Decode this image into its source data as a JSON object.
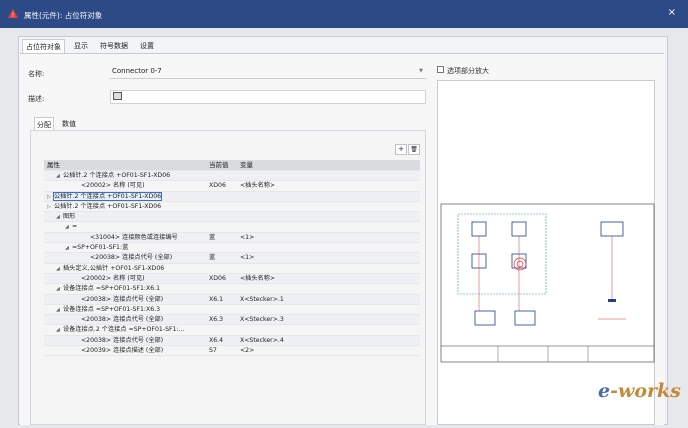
{
  "window": {
    "title": "属性(元件): 占位符对象",
    "close": "×"
  },
  "tabs": [
    "占位符对象",
    "显示",
    "符号数据",
    "设置"
  ],
  "form": {
    "name_label": "名称:",
    "name_value": "Connector 0-7",
    "desc_label": "描述:"
  },
  "subtabs": [
    "分配",
    "数值"
  ],
  "toolbar": {
    "add": "+",
    "delete": "🗑"
  },
  "table": {
    "headers": [
      "属性",
      "当前值",
      "变量"
    ],
    "rows": [
      {
        "indent": 1,
        "exp": "◢",
        "prop": "公插针.2 个连接点 +OF01-SF1-XD06",
        "val": "",
        "var": ""
      },
      {
        "indent": 3,
        "exp": "",
        "prop": "<20002> 名称 (可见)",
        "val": "XD06",
        "var": "<插头名称>"
      },
      {
        "indent": 0,
        "exp": "▷",
        "prop": "公插针.2 个连接点 +OF01-SF1-XD06",
        "val": "",
        "var": "",
        "sel": true
      },
      {
        "indent": 0,
        "exp": "▷",
        "prop": "公插针.2 个连接点 +OF01-SF1-XD06",
        "val": "",
        "var": ""
      },
      {
        "indent": 1,
        "exp": "◢",
        "prop": "图形",
        "val": "",
        "var": ""
      },
      {
        "indent": 2,
        "exp": "◢",
        "prop": "=",
        "val": "",
        "var": ""
      },
      {
        "indent": 4,
        "exp": "",
        "prop": "<31004> 连接颜色或连接编号",
        "val": "蓝",
        "var": "<1>"
      },
      {
        "indent": 2,
        "exp": "◢",
        "prop": "=SP+OF01-SF1:蓝",
        "val": "",
        "var": ""
      },
      {
        "indent": 4,
        "exp": "",
        "prop": "<20038> 连接点代号 (全部)",
        "val": "蓝",
        "var": "<1>"
      },
      {
        "indent": 1,
        "exp": "◢",
        "prop": "插头定义,公插针 +OF01-SF1-XD06",
        "val": "",
        "var": ""
      },
      {
        "indent": 3,
        "exp": "",
        "prop": "<20002> 名称 (可见)",
        "val": "XD06",
        "var": "<插头名称>"
      },
      {
        "indent": 1,
        "exp": "◢",
        "prop": "设备连接点 =SP+OF01-SF1:X6.1",
        "val": "",
        "var": ""
      },
      {
        "indent": 3,
        "exp": "",
        "prop": "<20038> 连接点代号 (全部)",
        "val": "X6.1",
        "var": "X<Stecker>.1"
      },
      {
        "indent": 1,
        "exp": "◢",
        "prop": "设备连接点 =SP+OF01-SF1:X6.3",
        "val": "",
        "var": ""
      },
      {
        "indent": 3,
        "exp": "",
        "prop": "<20038> 连接点代号 (全部)",
        "val": "X6.3",
        "var": "X<Stecker>.3"
      },
      {
        "indent": 1,
        "exp": "◢",
        "prop": "设备连接点.2 个连接点 =SP+OF01-SF1:...",
        "val": "",
        "var": ""
      },
      {
        "indent": 3,
        "exp": "",
        "prop": "<20038> 连接点代号 (全部)",
        "val": "X6.4",
        "var": "X<Stecker>.4"
      },
      {
        "indent": 3,
        "exp": "",
        "prop": "<20039> 连接点描述 (全部)",
        "val": "S7",
        "var": "<2>"
      }
    ]
  },
  "preview": {
    "zoom_label": "选项部分放大"
  },
  "watermark": {
    "first": "e",
    "rest": "-works"
  }
}
